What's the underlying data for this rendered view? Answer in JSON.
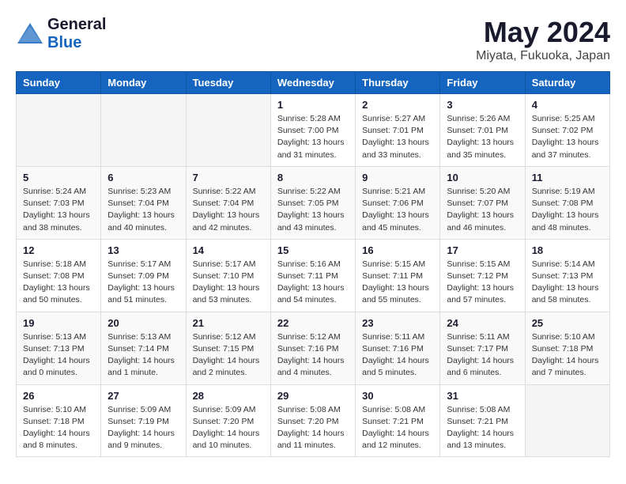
{
  "header": {
    "logo_general": "General",
    "logo_blue": "Blue",
    "month": "May 2024",
    "location": "Miyata, Fukuoka, Japan"
  },
  "weekdays": [
    "Sunday",
    "Monday",
    "Tuesday",
    "Wednesday",
    "Thursday",
    "Friday",
    "Saturday"
  ],
  "weeks": [
    [
      {
        "day": "",
        "info": ""
      },
      {
        "day": "",
        "info": ""
      },
      {
        "day": "",
        "info": ""
      },
      {
        "day": "1",
        "info": "Sunrise: 5:28 AM\nSunset: 7:00 PM\nDaylight: 13 hours\nand 31 minutes."
      },
      {
        "day": "2",
        "info": "Sunrise: 5:27 AM\nSunset: 7:01 PM\nDaylight: 13 hours\nand 33 minutes."
      },
      {
        "day": "3",
        "info": "Sunrise: 5:26 AM\nSunset: 7:01 PM\nDaylight: 13 hours\nand 35 minutes."
      },
      {
        "day": "4",
        "info": "Sunrise: 5:25 AM\nSunset: 7:02 PM\nDaylight: 13 hours\nand 37 minutes."
      }
    ],
    [
      {
        "day": "5",
        "info": "Sunrise: 5:24 AM\nSunset: 7:03 PM\nDaylight: 13 hours\nand 38 minutes."
      },
      {
        "day": "6",
        "info": "Sunrise: 5:23 AM\nSunset: 7:04 PM\nDaylight: 13 hours\nand 40 minutes."
      },
      {
        "day": "7",
        "info": "Sunrise: 5:22 AM\nSunset: 7:04 PM\nDaylight: 13 hours\nand 42 minutes."
      },
      {
        "day": "8",
        "info": "Sunrise: 5:22 AM\nSunset: 7:05 PM\nDaylight: 13 hours\nand 43 minutes."
      },
      {
        "day": "9",
        "info": "Sunrise: 5:21 AM\nSunset: 7:06 PM\nDaylight: 13 hours\nand 45 minutes."
      },
      {
        "day": "10",
        "info": "Sunrise: 5:20 AM\nSunset: 7:07 PM\nDaylight: 13 hours\nand 46 minutes."
      },
      {
        "day": "11",
        "info": "Sunrise: 5:19 AM\nSunset: 7:08 PM\nDaylight: 13 hours\nand 48 minutes."
      }
    ],
    [
      {
        "day": "12",
        "info": "Sunrise: 5:18 AM\nSunset: 7:08 PM\nDaylight: 13 hours\nand 50 minutes."
      },
      {
        "day": "13",
        "info": "Sunrise: 5:17 AM\nSunset: 7:09 PM\nDaylight: 13 hours\nand 51 minutes."
      },
      {
        "day": "14",
        "info": "Sunrise: 5:17 AM\nSunset: 7:10 PM\nDaylight: 13 hours\nand 53 minutes."
      },
      {
        "day": "15",
        "info": "Sunrise: 5:16 AM\nSunset: 7:11 PM\nDaylight: 13 hours\nand 54 minutes."
      },
      {
        "day": "16",
        "info": "Sunrise: 5:15 AM\nSunset: 7:11 PM\nDaylight: 13 hours\nand 55 minutes."
      },
      {
        "day": "17",
        "info": "Sunrise: 5:15 AM\nSunset: 7:12 PM\nDaylight: 13 hours\nand 57 minutes."
      },
      {
        "day": "18",
        "info": "Sunrise: 5:14 AM\nSunset: 7:13 PM\nDaylight: 13 hours\nand 58 minutes."
      }
    ],
    [
      {
        "day": "19",
        "info": "Sunrise: 5:13 AM\nSunset: 7:13 PM\nDaylight: 14 hours\nand 0 minutes."
      },
      {
        "day": "20",
        "info": "Sunrise: 5:13 AM\nSunset: 7:14 PM\nDaylight: 14 hours\nand 1 minute."
      },
      {
        "day": "21",
        "info": "Sunrise: 5:12 AM\nSunset: 7:15 PM\nDaylight: 14 hours\nand 2 minutes."
      },
      {
        "day": "22",
        "info": "Sunrise: 5:12 AM\nSunset: 7:16 PM\nDaylight: 14 hours\nand 4 minutes."
      },
      {
        "day": "23",
        "info": "Sunrise: 5:11 AM\nSunset: 7:16 PM\nDaylight: 14 hours\nand 5 minutes."
      },
      {
        "day": "24",
        "info": "Sunrise: 5:11 AM\nSunset: 7:17 PM\nDaylight: 14 hours\nand 6 minutes."
      },
      {
        "day": "25",
        "info": "Sunrise: 5:10 AM\nSunset: 7:18 PM\nDaylight: 14 hours\nand 7 minutes."
      }
    ],
    [
      {
        "day": "26",
        "info": "Sunrise: 5:10 AM\nSunset: 7:18 PM\nDaylight: 14 hours\nand 8 minutes."
      },
      {
        "day": "27",
        "info": "Sunrise: 5:09 AM\nSunset: 7:19 PM\nDaylight: 14 hours\nand 9 minutes."
      },
      {
        "day": "28",
        "info": "Sunrise: 5:09 AM\nSunset: 7:20 PM\nDaylight: 14 hours\nand 10 minutes."
      },
      {
        "day": "29",
        "info": "Sunrise: 5:08 AM\nSunset: 7:20 PM\nDaylight: 14 hours\nand 11 minutes."
      },
      {
        "day": "30",
        "info": "Sunrise: 5:08 AM\nSunset: 7:21 PM\nDaylight: 14 hours\nand 12 minutes."
      },
      {
        "day": "31",
        "info": "Sunrise: 5:08 AM\nSunset: 7:21 PM\nDaylight: 14 hours\nand 13 minutes."
      },
      {
        "day": "",
        "info": ""
      }
    ]
  ]
}
